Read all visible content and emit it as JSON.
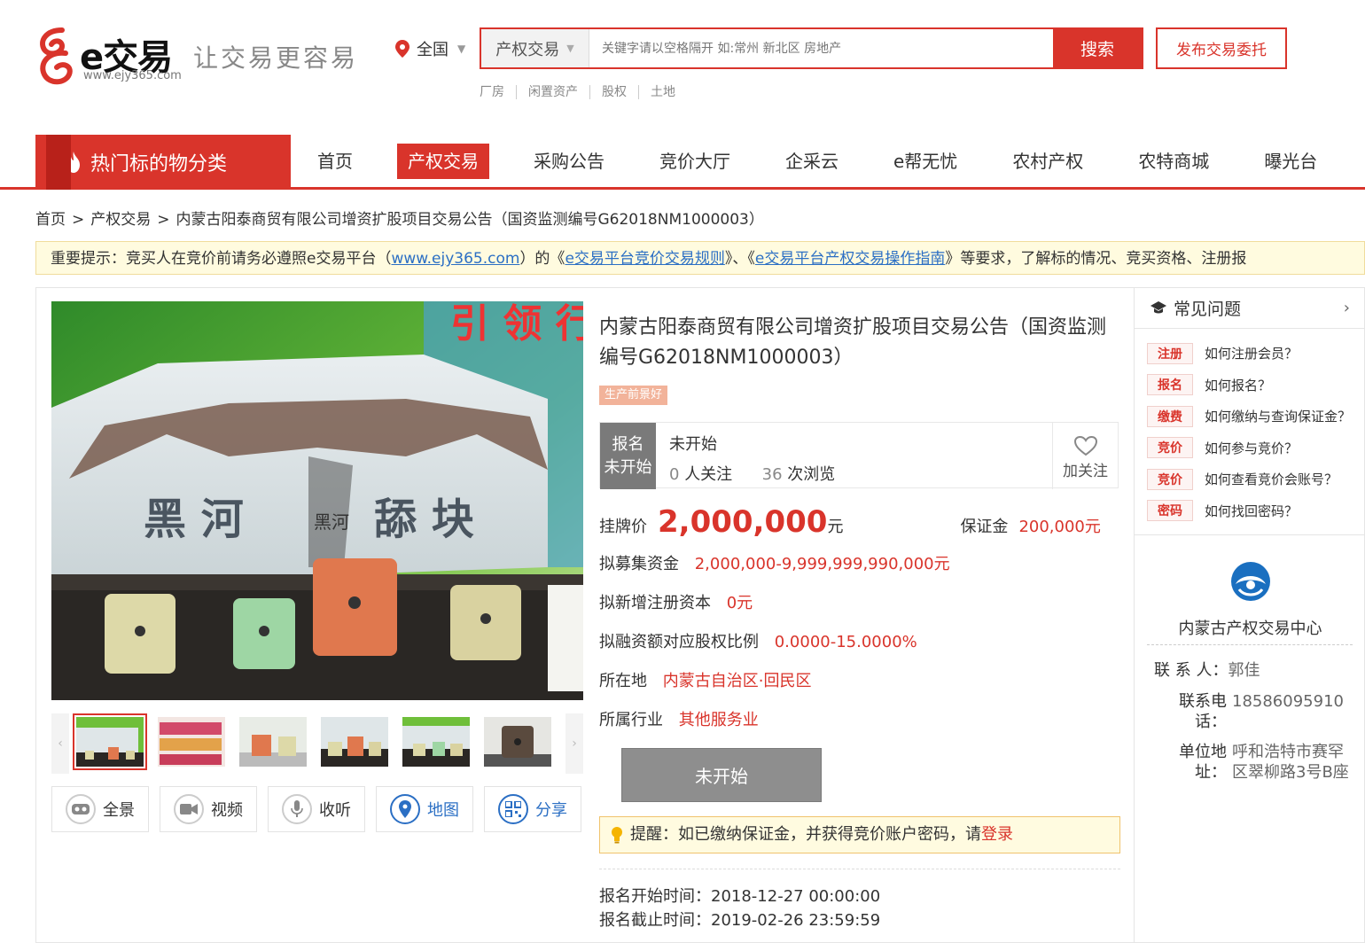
{
  "header": {
    "logo_text": "e交易",
    "logo_url": "www.ejy365.com",
    "slogan": "让交易更容易",
    "region": "全国",
    "search_category": "产权交易",
    "search_placeholder": "关键字请以空格隔开 如:常州 新北区 房地产",
    "search_button": "搜索",
    "publish_button": "发布交易委托",
    "hot_tags": [
      "厂房",
      "闲置资产",
      "股权",
      "土地"
    ]
  },
  "nav": {
    "category_label": "热门标的物分类",
    "items": [
      "首页",
      "产权交易",
      "采购公告",
      "竞价大厅",
      "企采云",
      "e帮无忧",
      "农村产权",
      "农特商城",
      "曝光台"
    ],
    "active_index": 1
  },
  "breadcrumb": [
    "首页",
    "产权交易",
    "内蒙古阳泰商贸有限公司增资扩股项目交易公告（国资监测编号G62018NM1000003）"
  ],
  "notice": {
    "prefix": "重要提示：竞买人在竞价前请务必遵照e交易平台（",
    "link1": "www.ejy365.com",
    "mid1": "）的《",
    "link2": "e交易平台竞价交易规则",
    "mid2": "》、《",
    "link3": "e交易平台产权交易操作指南",
    "suffix": "》等要求，了解标的情况、竞买资格、注册报"
  },
  "photo": {
    "sign_left": "黑 河",
    "sign_center": "黑河",
    "sign_right": "舔 块",
    "banner_text": "引 领 行"
  },
  "media_buttons": [
    "全景",
    "视频",
    "收听",
    "地图",
    "分享"
  ],
  "detail": {
    "title": "内蒙古阳泰商贸有限公司增资扩股项目交易公告（国资监测编号G62018NM1000003）",
    "tag": "生产前景好",
    "status_badge_line1": "报名",
    "status_badge_line2": "未开始",
    "status_text": "未开始",
    "followers": "0",
    "followers_label": "人关注",
    "views": "36",
    "views_label": "次浏览",
    "follow_label": "加关注",
    "price_label": "挂牌价",
    "price_value": "2,000,000",
    "price_unit": "元",
    "deposit_label": "保证金",
    "deposit_value": "200,000元",
    "fund_label": "拟募集资金",
    "fund_value": "2,000,000-9,999,999,990,000元",
    "capital_label": "拟新增注册资本",
    "capital_value": "0元",
    "equity_label": "拟融资额对应股权比例",
    "equity_value": "0.0000-15.0000%",
    "location_label": "所在地",
    "location_value": "内蒙古自治区·回民区",
    "industry_label": "所属行业",
    "industry_value": "其他服务业",
    "sign_button": "未开始",
    "reminder_text": "提醒：如已缴纳保证金，并获得竞价账户密码，请",
    "reminder_login": "登录",
    "start_time_label": "报名开始时间：",
    "start_time": "2018-12-27 00:00:00",
    "end_time_label": "报名截止时间：",
    "end_time": "2019-02-26 23:59:59"
  },
  "sidebar": {
    "faq_title": "常见问题",
    "faq": [
      {
        "tag": "注册",
        "q": "如何注册会员？"
      },
      {
        "tag": "报名",
        "q": "如何报名？"
      },
      {
        "tag": "缴费",
        "q": "如何缴纳与查询保证金？"
      },
      {
        "tag": "竞价",
        "q": "如何参与竞价？"
      },
      {
        "tag": "竞价",
        "q": "如何查看竞价会账号？"
      },
      {
        "tag": "密码",
        "q": "如何找回密码？"
      }
    ],
    "center_name": "内蒙古产权交易中心",
    "contact_label": "联 系 人：",
    "contact_value": "郭佳",
    "phone_label_1": "联系电",
    "phone_label_2": "话：",
    "phone_value": "18586095910",
    "address_label_1": "单位地",
    "address_label_2": "址：",
    "address_value_1": "呼和浩特市赛罕",
    "address_value_2": "区翠柳路3号B座"
  },
  "colors": {
    "brand_red": "#d9342b",
    "link_blue": "#2b6fc4",
    "status_gray": "#7a7a7a"
  }
}
